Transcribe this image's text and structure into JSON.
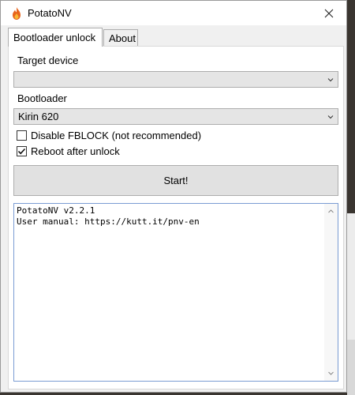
{
  "window": {
    "title": "PotatoNV",
    "icon": "flame-icon",
    "close_icon": "close-icon"
  },
  "tabs": [
    {
      "label": "Bootloader unlock",
      "active": true
    },
    {
      "label": "About",
      "active": false
    }
  ],
  "form": {
    "target_device_label": "Target device",
    "target_device_value": "",
    "bootloader_label": "Bootloader",
    "bootloader_value": "Kirin 620",
    "disable_fblock_label": "Disable FBLOCK (not recommended)",
    "disable_fblock_checked": false,
    "reboot_label": "Reboot after unlock",
    "reboot_checked": true,
    "start_label": "Start!"
  },
  "log": {
    "lines": "PotatoNV v2.2.1\nUser manual: https://kutt.it/pnv-en"
  },
  "colors": {
    "window_bg": "#f0f0f0",
    "panel_bg": "#ffffff",
    "accent_border": "#7a9cd3",
    "icon_flame": "#e8641b"
  }
}
